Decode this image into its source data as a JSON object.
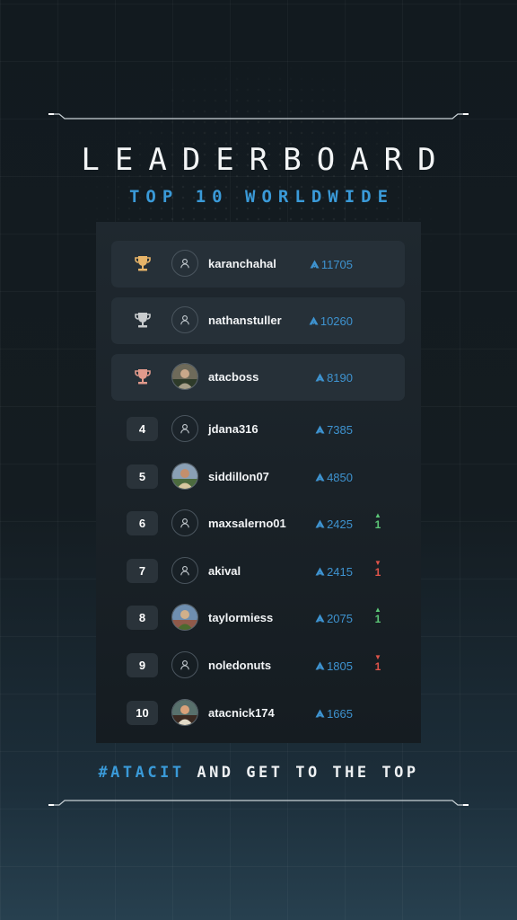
{
  "header": {
    "title": "LEADERBOARD",
    "subtitle": "TOP 10 WORLDWIDE"
  },
  "colors": {
    "accent_blue": "#3a9ad8",
    "gold": "#e7b468",
    "silver": "#c9ccce",
    "bronze": "#e29a8c",
    "up_green": "#5cc777",
    "down_red": "#e0544a"
  },
  "leaderboard": {
    "entries": [
      {
        "rank": "1",
        "username": "karanchahal",
        "score": "11705",
        "trophy": "gold-trophy-icon",
        "avatar": "default-user-icon",
        "change": null
      },
      {
        "rank": "2",
        "username": "nathanstuller",
        "score": "10260",
        "trophy": "silver-trophy-icon",
        "avatar": "default-user-icon",
        "change": null
      },
      {
        "rank": "3",
        "username": "atacboss",
        "score": "8190",
        "trophy": "bronze-trophy-icon",
        "avatar": "profile-photo",
        "change": null
      },
      {
        "rank": "4",
        "username": "jdana316",
        "score": "7385",
        "avatar": "default-user-icon",
        "change": null
      },
      {
        "rank": "5",
        "username": "siddillon07",
        "score": "4850",
        "avatar": "profile-photo",
        "change": null
      },
      {
        "rank": "6",
        "username": "maxsalerno01",
        "score": "2425",
        "avatar": "default-user-icon",
        "change": {
          "direction": "up",
          "amount": "1"
        }
      },
      {
        "rank": "7",
        "username": "akival",
        "score": "2415",
        "avatar": "default-user-icon",
        "change": {
          "direction": "down",
          "amount": "1"
        }
      },
      {
        "rank": "8",
        "username": "taylormiess",
        "score": "2075",
        "avatar": "profile-photo",
        "change": {
          "direction": "up",
          "amount": "1"
        }
      },
      {
        "rank": "9",
        "username": "noledonuts",
        "score": "1805",
        "avatar": "default-user-icon",
        "change": {
          "direction": "down",
          "amount": "1"
        }
      },
      {
        "rank": "10",
        "username": "atacnick174",
        "score": "1665",
        "avatar": "profile-photo",
        "change": null
      }
    ]
  },
  "footer": {
    "hashtag": "#ATACIT",
    "text": " AND GET TO THE TOP"
  }
}
